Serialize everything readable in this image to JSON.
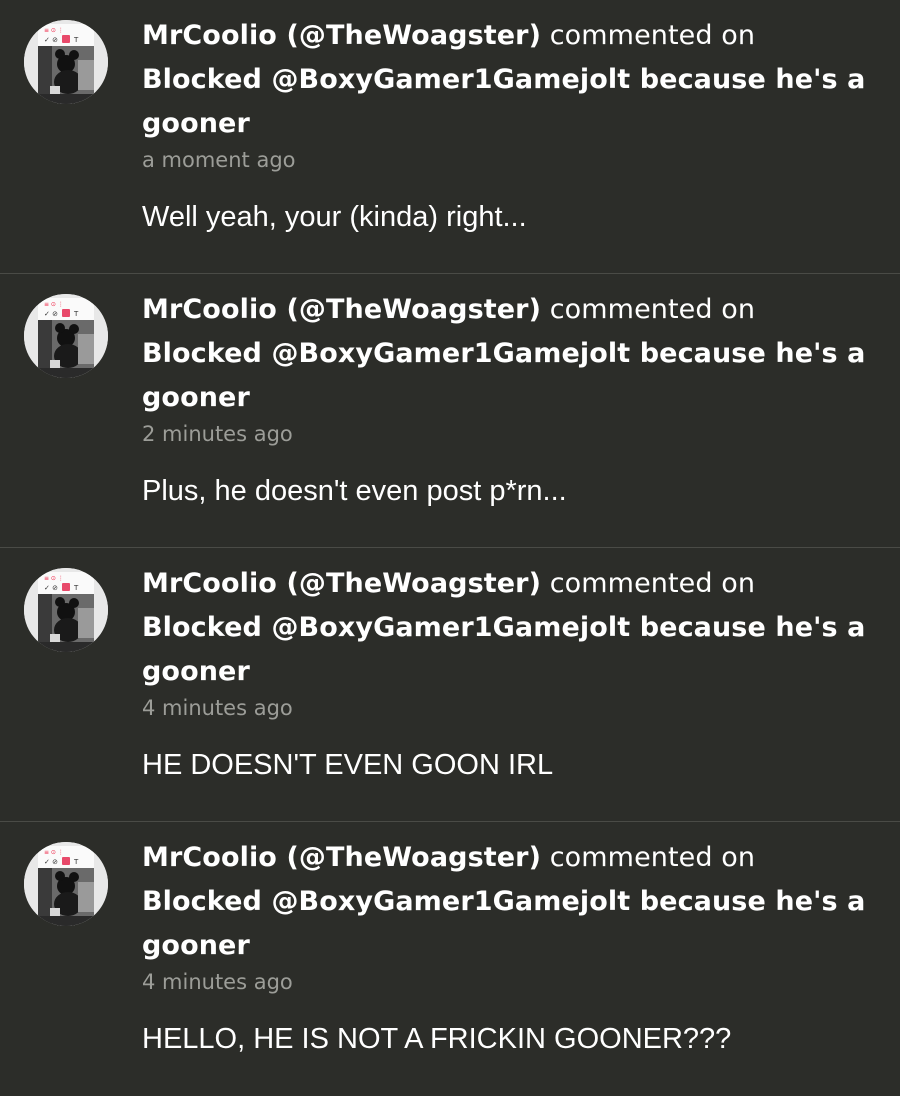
{
  "notifications": [
    {
      "avatar_icon": "user-avatar",
      "username": "MrCoolio (@TheWoagster)",
      "action": "commented on",
      "post_title": "Blocked @BoxyGamer1Gamejolt because he's a gooner",
      "time": "a moment ago",
      "message": "Well yeah, your (kinda) right..."
    },
    {
      "avatar_icon": "user-avatar",
      "username": "MrCoolio (@TheWoagster)",
      "action": "commented on",
      "post_title": "Blocked @BoxyGamer1Gamejolt because he's a gooner",
      "time": "2 minutes ago",
      "message": "Plus, he doesn't even post p*rn..."
    },
    {
      "avatar_icon": "user-avatar",
      "username": "MrCoolio (@TheWoagster)",
      "action": "commented on",
      "post_title": "Blocked @BoxyGamer1Gamejolt because he's a gooner",
      "time": "4 minutes ago",
      "message": "HE DOESN'T EVEN GOON IRL"
    },
    {
      "avatar_icon": "user-avatar",
      "username": "MrCoolio (@TheWoagster)",
      "action": "commented on",
      "post_title": "Blocked @BoxyGamer1Gamejolt because he's a gooner",
      "time": "4 minutes ago",
      "message": "HELLO, HE IS NOT A FRICKIN GOONER???"
    }
  ],
  "colors": {
    "background": "#2c2d29",
    "divider": "#4a4b46",
    "text": "#ffffff",
    "muted": "#9c9d98"
  }
}
